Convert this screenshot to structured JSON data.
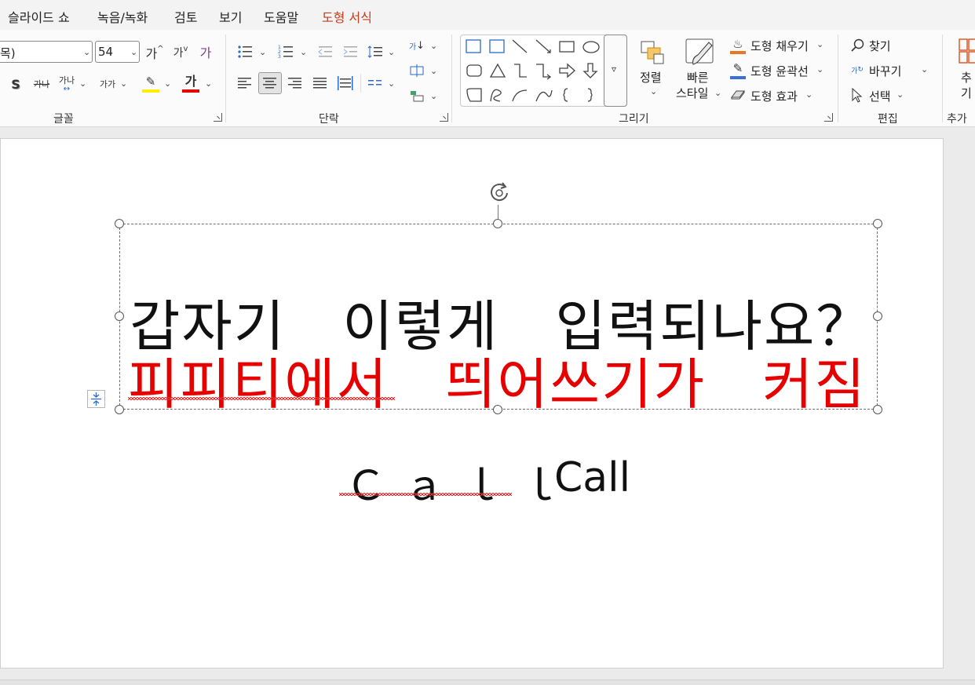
{
  "menu": {
    "items": [
      "슬라이드 쇼",
      "녹음/녹화",
      "검토",
      "보기",
      "도움말",
      "도형 서식"
    ],
    "active_color": "#c43e1c"
  },
  "ribbon": {
    "font": {
      "font_name": "목)",
      "font_size": "54",
      "grow_label": "가",
      "shrink_label": "가",
      "clear_format_label": "가",
      "shadow_label": "S",
      "strike_label": "가나",
      "spacing_label": "가나",
      "case_label": "가가",
      "font_color_label": "가",
      "highlight_color": "#ffee00",
      "font_color": "#e60000",
      "group_label": "글꼴"
    },
    "paragraph": {
      "group_label": "단락",
      "direction_label": "가",
      "align_label": "가"
    },
    "drawing": {
      "group_label": "그리기",
      "arrange_label": "정렬",
      "quick_styles_line1": "빠른",
      "quick_styles_line2": "스타일",
      "fill_label": "도형 채우기",
      "outline_label": "도형 윤곽선",
      "effects_label": "도형 효과",
      "fill_color": "#e87722",
      "outline_color": "#3a6fd8"
    },
    "editing": {
      "group_label": "편집",
      "find_label": "찾기",
      "replace_label": "바꾸기",
      "replace_icon_label": "가",
      "select_label": "선택"
    },
    "addins": {
      "group_label": "추가",
      "button_line1": "추",
      "button_line2": "기"
    }
  },
  "slide": {
    "line1": "갑자기　이렇게　입력되나요？",
    "line2": "피피티에서　띄어쓰기가　커짐",
    "line3a": "Ｃａｌｌ",
    "line3b": "Call",
    "line2_color": "#e60000"
  }
}
